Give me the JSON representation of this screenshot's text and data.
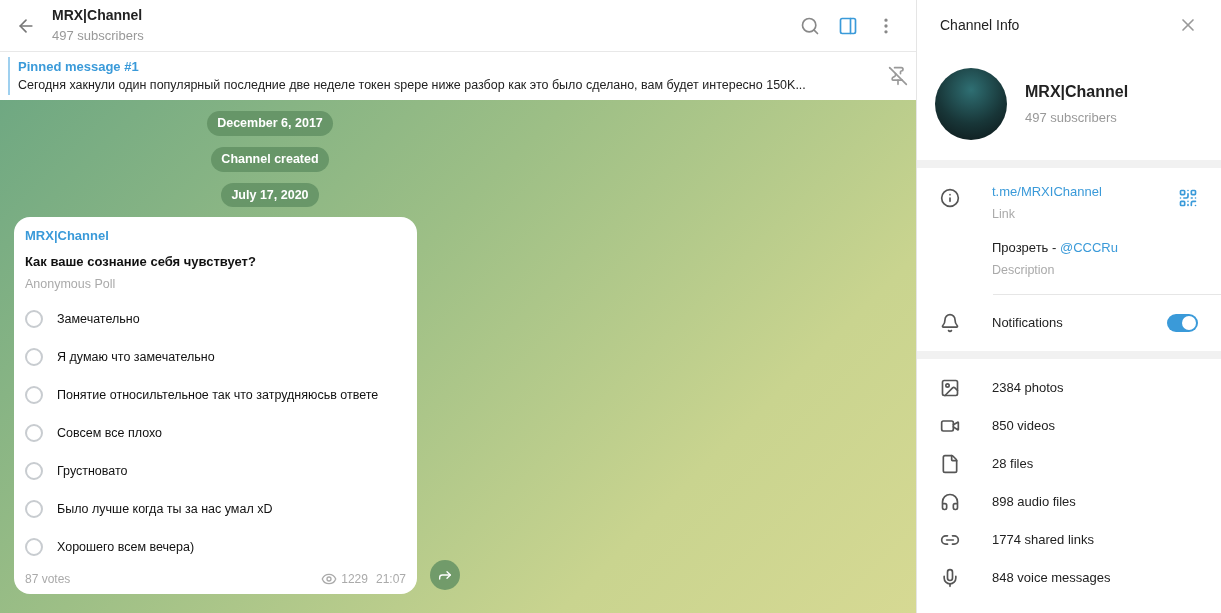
{
  "header": {
    "title": "MRX|Channel",
    "subtitle": "497 subscribers"
  },
  "pinned": {
    "label": "Pinned message #1",
    "text": "Сегодня хакнули один популярный последние две неделе токен spepe ниже разбор как это было сделано, вам будет интересно 150K..."
  },
  "service_messages": [
    "December 6, 2017",
    "Channel created",
    "July 17, 2020"
  ],
  "poll": {
    "author": "MRX|Channel",
    "question": "Как ваше сознание себя чувствует?",
    "type": "Anonymous Poll",
    "options": [
      {
        "text": "Замечательно",
        "selected": false
      },
      {
        "text": "Я думаю что замечательно",
        "selected": false
      },
      {
        "text": "Понятие относильтельное так что затрудняюсьв ответе",
        "selected": false
      },
      {
        "text": "Совсем все плохо",
        "selected": false
      },
      {
        "text": "Грустновато",
        "selected": false
      },
      {
        "text": "Было лучше когда ты за нас умал xD",
        "selected": false
      },
      {
        "text": "Хорошего всем вечера)",
        "selected": false
      }
    ],
    "votes": "87 votes",
    "views": "1229",
    "time": "21:07"
  },
  "info_panel": {
    "title": "Channel Info",
    "name": "MRX|Channel",
    "subscribers": "497 subscribers",
    "link": {
      "value": "t.me/MRXIChannel",
      "label": "Link"
    },
    "description": {
      "text": "Прозреть - ",
      "mention": "@CCCRu",
      "label": "Description"
    },
    "notifications": {
      "label": "Notifications",
      "on": true
    },
    "media": [
      {
        "kind": "photos",
        "text": "2384 photos"
      },
      {
        "kind": "videos",
        "text": "850 videos"
      },
      {
        "kind": "files",
        "text": "28 files"
      },
      {
        "kind": "audio",
        "text": "898 audio files"
      },
      {
        "kind": "links",
        "text": "1774 shared links"
      },
      {
        "kind": "voice",
        "text": "848 voice messages"
      }
    ]
  }
}
